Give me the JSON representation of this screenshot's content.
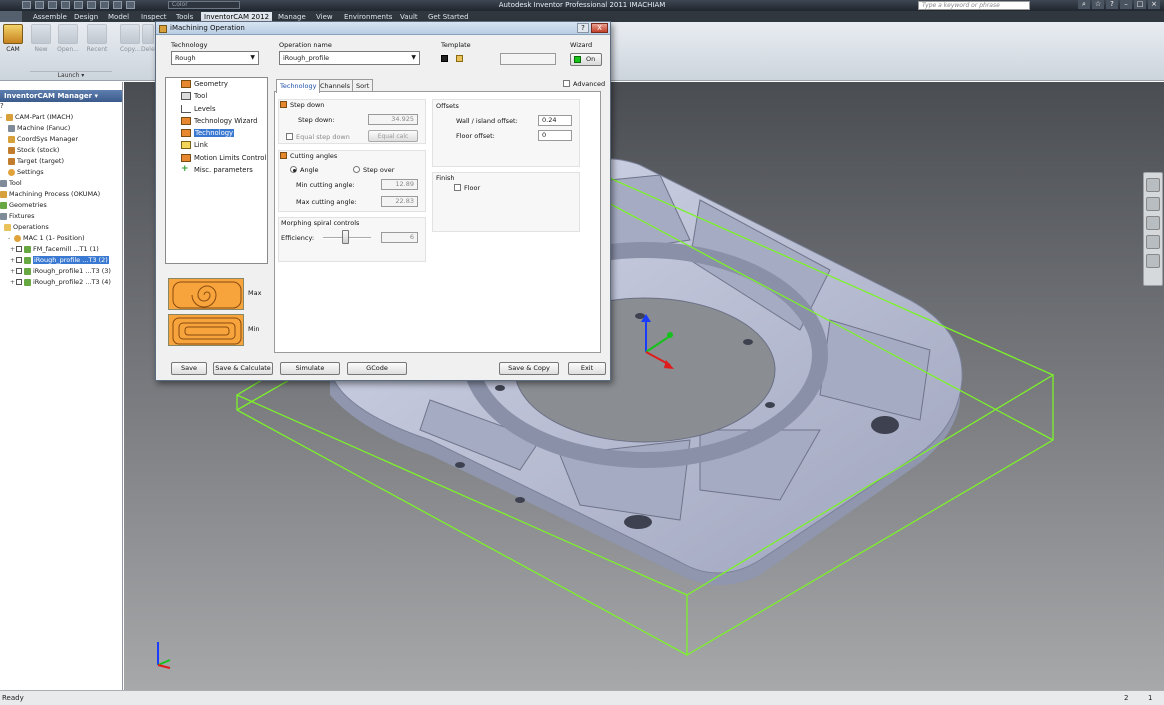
{
  "app": {
    "title": "Autodesk Inventor Professional 2011    IMACHIAM",
    "color_dropdown": "Color",
    "search_placeholder": "Type a keyword or phrase",
    "status_left": "Ready",
    "status_right_1": "2",
    "status_right_2": "1"
  },
  "ribbon_tabs": [
    "Assemble",
    "Design",
    "Model",
    "Inspect",
    "Tools",
    "InventorCAM 2012",
    "Manage",
    "View",
    "Environments",
    "Vault",
    "Get Started"
  ],
  "ribbon_active_tab": "InventorCAM 2012",
  "ribbon_buttons": {
    "cam": "CAM",
    "new": "New",
    "open": "Open...",
    "recent": "Recent",
    "copy": "Copy...",
    "delete": "Delete",
    "group_label": "Launch ▾"
  },
  "browser": {
    "header": "InventorCAM Manager ▾",
    "help": "?",
    "items": [
      "CAM-Part (IMACH)",
      "Machine (Fanuc)",
      "CoordSys Manager",
      "Stock (stock)",
      "Target (target)",
      "Settings",
      "Tool",
      "Machining Process (OKUMA)",
      "Geometries",
      "Fixtures",
      "Operations",
      "MAC 1 (1- Position)",
      "FM_facemill ...T1 (1)",
      "iRough_profile ...T3 (2)",
      "iRough_profile1 ...T3 (3)",
      "iRough_profile2 ...T3 (4)"
    ]
  },
  "dialog": {
    "title": "iMachining Operation",
    "help": "?",
    "close": "X",
    "technology_label": "Technology",
    "technology_value": "Rough",
    "operation_name_label": "Operation name",
    "operation_name_value": "iRough_profile",
    "template_label": "Template",
    "wizard_label": "Wizard",
    "wizard_value": "On",
    "tree": [
      "Geometry",
      "Tool",
      "Levels",
      "Technology Wizard",
      "Technology",
      "Link",
      "Motion Limits Control",
      "Misc. parameters"
    ],
    "tree_selected": "Technology",
    "img_max": "Max",
    "img_min": "Min",
    "tabs": [
      "Technology",
      "Channels",
      "Sort"
    ],
    "advanced_label": "Advanced",
    "step_down_group": "Step down",
    "step_down_label": "Step down:",
    "step_down_value": "34.925",
    "equal_step_down": "Equal step down",
    "equal_step_down_btn": "Equal calc",
    "cutting_angles_group": "Cutting angles",
    "angle_radio": "Angle",
    "step_over_radio": "Step over",
    "min_cutting_angle_label": "Min cutting angle:",
    "min_cutting_angle_value": "12.89",
    "max_cutting_angle_label": "Max cutting angle:",
    "max_cutting_angle_value": "22.83",
    "morphing_group": "Morphing spiral controls",
    "efficiency_label": "Efficiency:",
    "efficiency_value": "6",
    "offsets_group": "Offsets",
    "wall_offset_label": "Wall / island offset:",
    "wall_offset_value": "0.24",
    "floor_offset_label": "Floor offset:",
    "floor_offset_value": "0",
    "finish_group": "Finish",
    "floor_checkbox": "Floor",
    "buttons": {
      "save": "Save",
      "save_calc": "Save & Calculate",
      "simulate": "Simulate",
      "gcode": "GCode",
      "save_copy": "Save & Copy",
      "exit": "Exit"
    }
  },
  "colors": {
    "wireframe": "#7cf22a",
    "part": "#b9bfd6",
    "selection": "#3a79d2"
  }
}
